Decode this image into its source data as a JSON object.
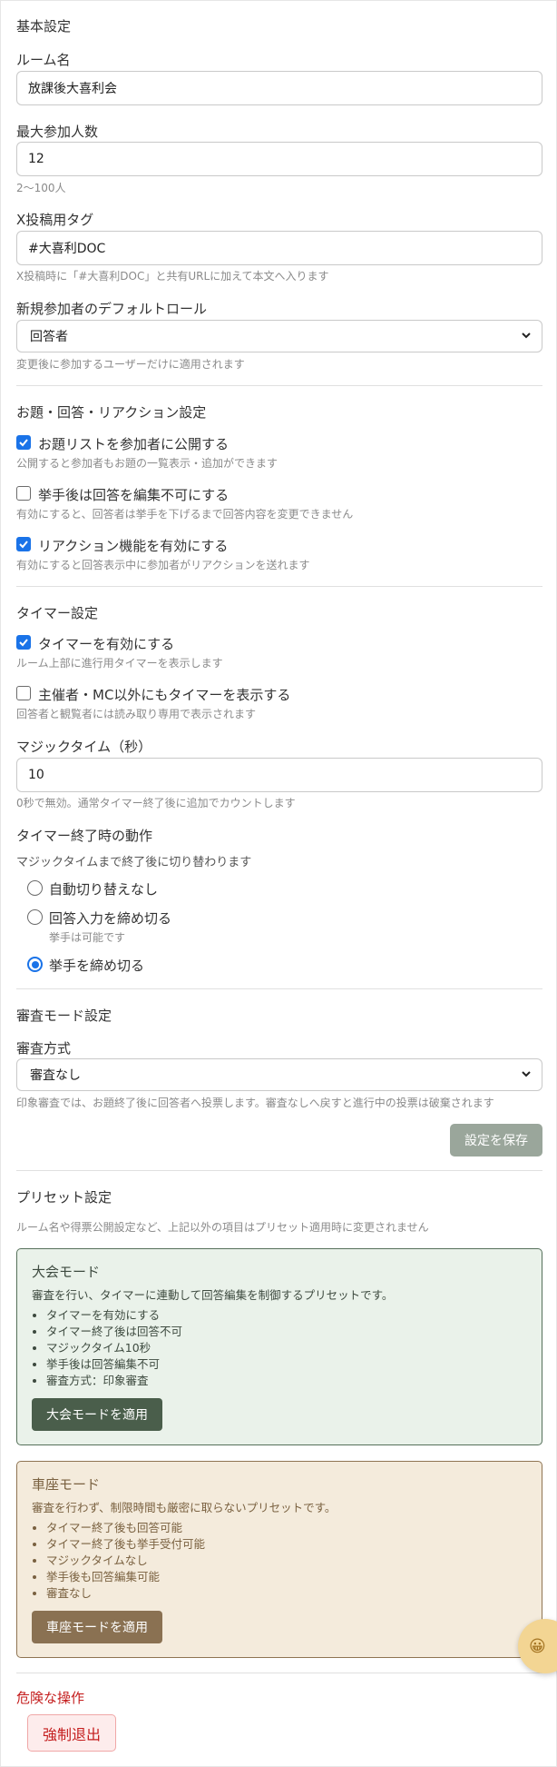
{
  "basic": {
    "section_title": "基本設定",
    "room_name_label": "ルーム名",
    "room_name_value": "放課後大喜利会",
    "max_participants_label": "最大参加人数",
    "max_participants_value": "12",
    "max_participants_help": "2〜100人",
    "x_tag_label": "X投稿用タグ",
    "x_tag_value": "#大喜利DOC",
    "x_tag_help": "X投稿時に「#大喜利DOC」と共有URLに加えて本文へ入ります",
    "default_role_label": "新規参加者のデフォルトロール",
    "default_role_value": "回答者",
    "default_role_help": "変更後に参加するユーザーだけに適用されます"
  },
  "topics": {
    "section_title": "お題・回答・リアクション設定",
    "publish_list_label": "お題リストを参加者に公開する",
    "publish_list_checked": true,
    "publish_list_help": "公開すると参加者もお題の一覧表示・追加ができます",
    "lock_edit_label": "挙手後は回答を編集不可にする",
    "lock_edit_checked": false,
    "lock_edit_help": "有効にすると、回答者は挙手を下げるまで回答内容を変更できません",
    "reaction_label": "リアクション機能を有効にする",
    "reaction_checked": true,
    "reaction_help": "有効にすると回答表示中に参加者がリアクションを送れます"
  },
  "timer": {
    "section_title": "タイマー設定",
    "enable_label": "タイマーを有効にする",
    "enable_checked": true,
    "enable_help": "ルーム上部に進行用タイマーを表示します",
    "show_all_label": "主催者・MC以外にもタイマーを表示する",
    "show_all_checked": false,
    "show_all_help": "回答者と観覧者には読み取り専用で表示されます",
    "magic_time_label": "マジックタイム（秒）",
    "magic_time_value": "10",
    "magic_time_help": "0秒で無効。通常タイマー終了後に追加でカウントします",
    "end_action_label": "タイマー終了時の動作",
    "end_action_help": "マジックタイムまで終了後に切り替わります",
    "options": [
      {
        "label": "自動切り替えなし",
        "sub": ""
      },
      {
        "label": "回答入力を締め切る",
        "sub": "挙手は可能です"
      },
      {
        "label": "挙手を締め切る",
        "sub": ""
      }
    ],
    "selected_index": 2
  },
  "review": {
    "section_title": "審査モード設定",
    "method_label": "審査方式",
    "method_value": "審査なし",
    "method_help": "印象審査では、お題終了後に回答者へ投票します。審査なしへ戻すと進行中の投票は破棄されます",
    "save_label": "設定を保存"
  },
  "presets": {
    "section_title": "プリセット設定",
    "help": "ルーム名や得票公開設定など、上記以外の項目はプリセット適用時に変更されません",
    "tournament": {
      "title": "大会モード",
      "desc": "審査を行い、タイマーに連動して回答編集を制御するプリセットです。",
      "items": [
        "タイマーを有効にする",
        "タイマー終了後は回答不可",
        "マジックタイム10秒",
        "挙手後は回答編集不可",
        "審査方式：印象審査"
      ],
      "apply_label": "大会モードを適用"
    },
    "casual": {
      "title": "車座モード",
      "desc": "審査を行わず、制限時間も厳密に取らないプリセットです。",
      "items": [
        "タイマー終了後も回答可能",
        "タイマー終了後も挙手受付可能",
        "マジックタイムなし",
        "挙手後も回答編集可能",
        "審査なし"
      ],
      "apply_label": "車座モードを適用"
    }
  },
  "danger": {
    "section_title": "危険な操作",
    "force_exit_label": "強制退出"
  },
  "floating": {
    "icon": "smile-icon",
    "glyph": "😀"
  },
  "colors": {
    "accent": "#1a73e8",
    "danger": "#c41d1d",
    "save": "#9aa69b",
    "tournament": "#4a5e4b",
    "casual": "#8a7152"
  }
}
